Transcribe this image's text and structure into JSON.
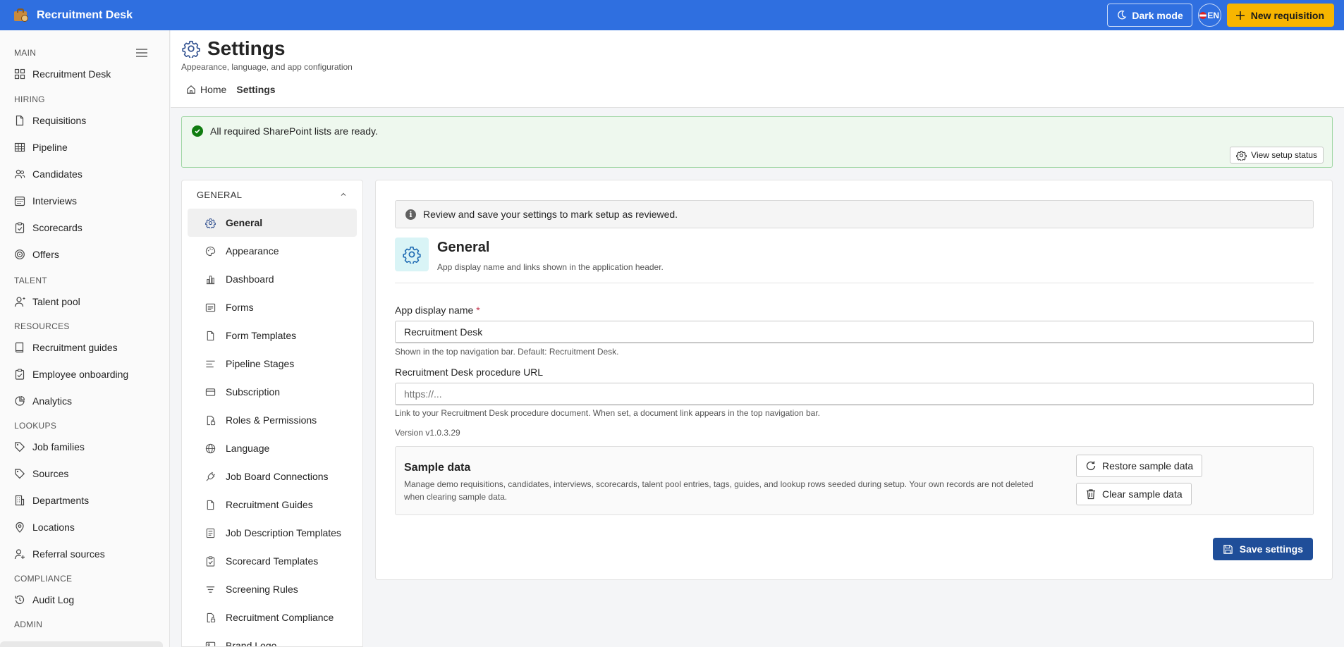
{
  "app": {
    "title": "Recruitment Desk"
  },
  "header": {
    "dark_mode_label": "Dark mode",
    "language_code": "EN",
    "new_requisition_label": "New requisition"
  },
  "sidebar": {
    "sections": [
      {
        "label": "MAIN",
        "items": [
          {
            "label": "Recruitment Desk",
            "icon": "dashboard-icon"
          }
        ]
      },
      {
        "label": "HIRING",
        "items": [
          {
            "label": "Requisitions",
            "icon": "document-icon"
          },
          {
            "label": "Pipeline",
            "icon": "grid-icon"
          },
          {
            "label": "Candidates",
            "icon": "people-icon"
          },
          {
            "label": "Interviews",
            "icon": "calendar-icon"
          },
          {
            "label": "Scorecards",
            "icon": "clipboard-icon"
          },
          {
            "label": "Offers",
            "icon": "target-icon"
          }
        ]
      },
      {
        "label": "TALENT",
        "items": [
          {
            "label": "Talent pool",
            "icon": "person-icon"
          }
        ]
      },
      {
        "label": "RESOURCES",
        "items": [
          {
            "label": "Recruitment guides",
            "icon": "book-icon"
          },
          {
            "label": "Employee onboarding",
            "icon": "clipboard-check-icon"
          },
          {
            "label": "Analytics",
            "icon": "chart-icon"
          }
        ]
      },
      {
        "label": "LOOKUPS",
        "items": [
          {
            "label": "Job families",
            "icon": "tag-icon"
          },
          {
            "label": "Sources",
            "icon": "tag-icon"
          },
          {
            "label": "Departments",
            "icon": "building-icon"
          },
          {
            "label": "Locations",
            "icon": "location-icon"
          },
          {
            "label": "Referral sources",
            "icon": "person-add-icon"
          }
        ]
      },
      {
        "label": "COMPLIANCE",
        "items": [
          {
            "label": "Audit Log",
            "icon": "history-icon"
          }
        ]
      },
      {
        "label": "ADMIN",
        "items": []
      }
    ]
  },
  "page": {
    "title": "Settings",
    "subtitle": "Appearance, language, and app configuration",
    "breadcrumb": {
      "home": "Home",
      "current": "Settings"
    }
  },
  "banner": {
    "message": "All required SharePoint lists are ready.",
    "button_label": "View setup status"
  },
  "settings_nav": {
    "group_label": "GENERAL",
    "items": [
      {
        "label": "General",
        "icon": "gear-icon",
        "active": true
      },
      {
        "label": "Appearance",
        "icon": "palette-icon"
      },
      {
        "label": "Dashboard",
        "icon": "chart-icon"
      },
      {
        "label": "Forms",
        "icon": "form-icon"
      },
      {
        "label": "Form Templates",
        "icon": "document-icon"
      },
      {
        "label": "Pipeline Stages",
        "icon": "list-icon"
      },
      {
        "label": "Subscription",
        "icon": "card-icon"
      },
      {
        "label": "Roles & Permissions",
        "icon": "lock-icon"
      },
      {
        "label": "Language",
        "icon": "globe-icon"
      },
      {
        "label": "Job Board Connections",
        "icon": "plug-icon"
      },
      {
        "label": "Recruitment Guides",
        "icon": "document-icon"
      },
      {
        "label": "Job Description Templates",
        "icon": "document-list-icon"
      },
      {
        "label": "Scorecard Templates",
        "icon": "clipboard-icon"
      },
      {
        "label": "Screening Rules",
        "icon": "filter-icon"
      },
      {
        "label": "Recruitment Compliance",
        "icon": "lock-icon"
      },
      {
        "label": "Brand Logo",
        "icon": "image-icon"
      }
    ]
  },
  "content": {
    "info_message": "Review and save your settings to mark setup as reviewed.",
    "section_title": "General",
    "section_description": "App display name and links shown in the application header.",
    "app_name": {
      "label": "App display name",
      "required_marker": "*",
      "value": "Recruitment Desk",
      "hint": "Shown in the top navigation bar. Default: Recruitment Desk."
    },
    "procedure_url": {
      "label": "Recruitment Desk procedure URL",
      "value": "",
      "placeholder": "https://...",
      "hint": "Link to your Recruitment Desk procedure document. When set, a document link appears in the top navigation bar."
    },
    "version": "Version v1.0.3.29",
    "sample_data": {
      "title": "Sample data",
      "description": "Manage demo requisitions, candidates, interviews, scorecards, talent pool entries, tags, guides, and lookup rows seeded during setup. Your own records are not deleted when clearing sample data.",
      "restore_label": "Restore sample data",
      "clear_label": "Clear sample data"
    },
    "save_label": "Save settings"
  },
  "colors": {
    "header_bg": "#2f6fe0",
    "accent_yellow": "#f7b500",
    "primary_button": "#1f4e99",
    "success": "#107c10"
  }
}
